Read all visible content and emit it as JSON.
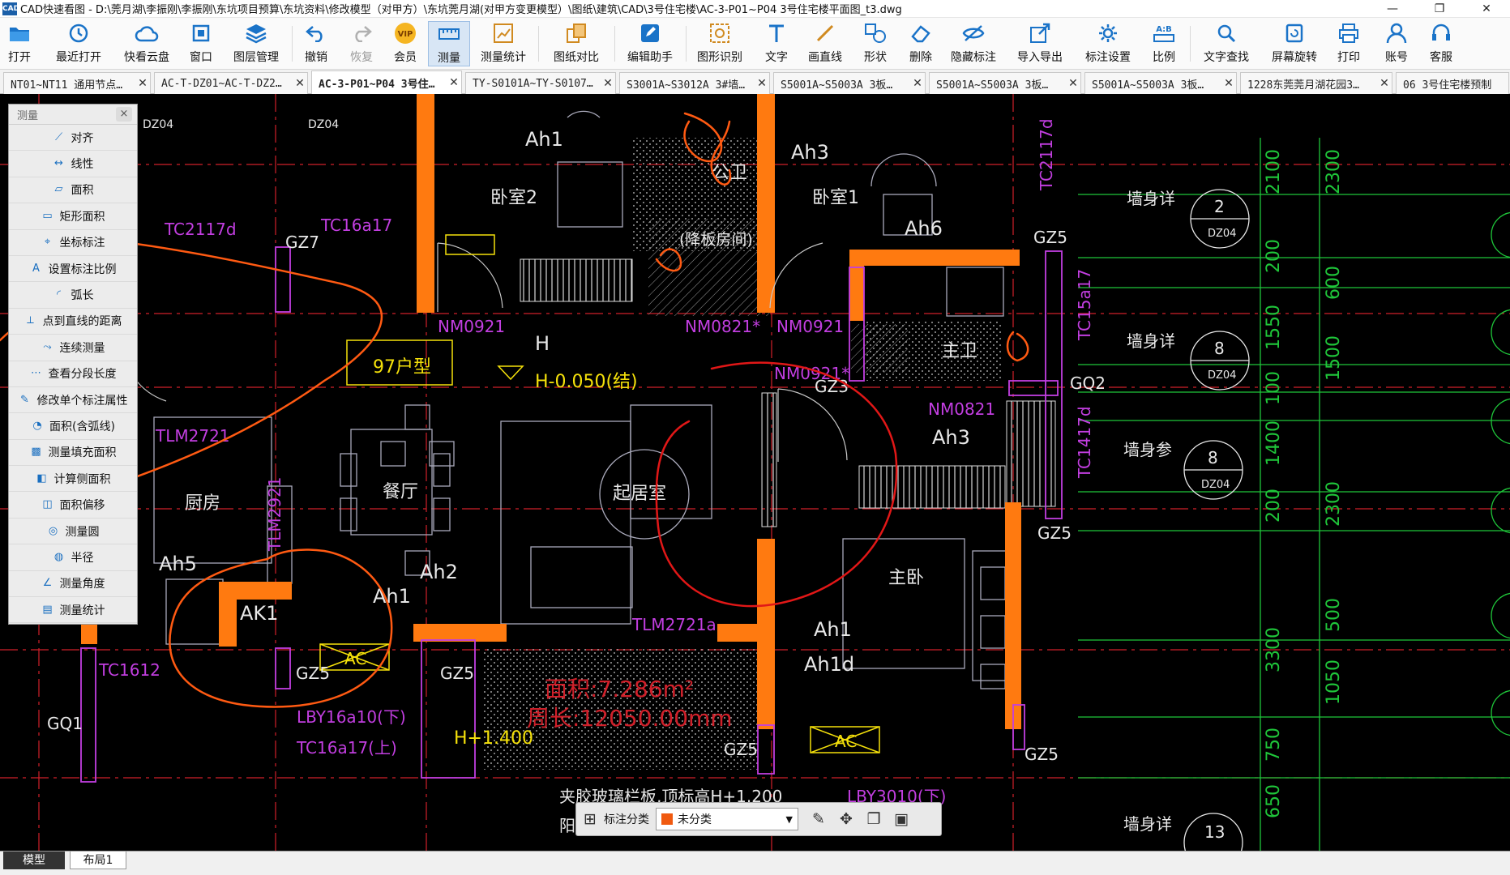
{
  "window": {
    "title": "CAD快速看图 - D:\\莞月湖\\李振刚\\李振刚\\东坑项目预算\\东坑资料\\修改模型（对甲方）\\东坑莞月湖(对甲方变更模型）\\图纸\\建筑\\CAD\\3号住宅楼\\AC-3-P01~P04 3号住宅楼平面图_t3.dwg",
    "logo": "CAD",
    "minimize": "—",
    "maximize": "❐",
    "close": "✕"
  },
  "toolbar": [
    {
      "label": "打开",
      "icon": "folder-icon"
    },
    {
      "label": "最近打开",
      "icon": "history-icon"
    },
    {
      "label": "快看云盘",
      "icon": "cloud-icon"
    },
    {
      "label": "窗口",
      "icon": "window-icon"
    },
    {
      "label": "图层管理",
      "icon": "layers-icon"
    },
    {
      "label": "撤销",
      "icon": "undo-icon"
    },
    {
      "label": "恢复",
      "icon": "redo-icon"
    },
    {
      "label": "会员",
      "icon": "vip-icon",
      "badge": "VIP"
    },
    {
      "label": "测量",
      "icon": "ruler-icon"
    },
    {
      "label": "测量统计",
      "icon": "measure-stats-icon"
    },
    {
      "label": "图纸对比",
      "icon": "compare-icon"
    },
    {
      "label": "编辑助手",
      "icon": "edit-helper-icon"
    },
    {
      "label": "图形识别",
      "icon": "shape-recognize-icon"
    },
    {
      "label": "文字",
      "icon": "text-icon"
    },
    {
      "label": "画直线",
      "icon": "line-icon"
    },
    {
      "label": "形状",
      "icon": "shape-icon"
    },
    {
      "label": "删除",
      "icon": "eraser-icon"
    },
    {
      "label": "隐藏标注",
      "icon": "eye-hide-icon"
    },
    {
      "label": "导入导出",
      "icon": "import-export-icon"
    },
    {
      "label": "标注设置",
      "icon": "annotation-settings-icon"
    },
    {
      "label": "比例",
      "icon": "scale-icon",
      "badge": "A:B"
    },
    {
      "label": "文字查找",
      "icon": "text-search-icon"
    },
    {
      "label": "屏幕旋转",
      "icon": "rotate-screen-icon"
    },
    {
      "label": "打印",
      "icon": "print-icon"
    },
    {
      "label": "账号",
      "icon": "user-icon"
    },
    {
      "label": "客服",
      "icon": "headset-icon"
    }
  ],
  "tabs": [
    {
      "label": "NT01~NT11 通用节点…",
      "close": "✕"
    },
    {
      "label": "AC-T-DZ01~AC-T-DZ2…",
      "close": "✕"
    },
    {
      "label": "AC-3-P01~P04 3号住…",
      "close": "✕",
      "active": true
    },
    {
      "label": "TY-S0101A~TY-S0107…",
      "close": "✕"
    },
    {
      "label": "S3001A~S3012A 3#墙…",
      "close": "✕"
    },
    {
      "label": "S5001A~S5003A 3板…",
      "close": "✕"
    },
    {
      "label": "S5001A~S5003A 3板…",
      "close": "✕"
    },
    {
      "label": "S5001A~S5003A 3板…",
      "close": "✕"
    },
    {
      "label": "1228东莞莞月湖花园3…",
      "close": "✕"
    },
    {
      "label": "06 3号住宅楼预制",
      "close": ""
    }
  ],
  "measure_panel": {
    "title": "测量",
    "close": "×",
    "items": [
      {
        "label": "对齐",
        "icon": "align-measure-icon",
        "glyph": "⟋"
      },
      {
        "label": "线性",
        "icon": "linear-measure-icon",
        "glyph": "↔"
      },
      {
        "label": "面积",
        "icon": "area-measure-icon",
        "glyph": "▱"
      },
      {
        "label": "矩形面积",
        "icon": "rect-area-icon",
        "glyph": "▭"
      },
      {
        "label": "坐标标注",
        "icon": "coordinate-icon",
        "glyph": "⌖"
      },
      {
        "label": "设置标注比例",
        "icon": "scale-setting-icon",
        "glyph": "A"
      },
      {
        "label": "弧长",
        "icon": "arc-length-icon",
        "glyph": "◜"
      },
      {
        "label": "点到直线的距离",
        "icon": "point-line-distance-icon",
        "glyph": "⟂"
      },
      {
        "label": "连续测量",
        "icon": "continuous-measure-icon",
        "glyph": "⤳"
      },
      {
        "label": "查看分段长度",
        "icon": "segment-length-icon",
        "glyph": "⋯"
      },
      {
        "label": "修改单个标注属性",
        "icon": "edit-annotation-icon",
        "glyph": "✎"
      },
      {
        "label": "面积(含弧线)",
        "icon": "arc-area-icon",
        "glyph": "◔"
      },
      {
        "label": "测量填充面积",
        "icon": "fill-area-icon",
        "glyph": "▩"
      },
      {
        "label": "计算侧面积",
        "icon": "side-area-icon",
        "glyph": "◧"
      },
      {
        "label": "面积偏移",
        "icon": "area-offset-icon",
        "glyph": "◫"
      },
      {
        "label": "测量圆",
        "icon": "circle-measure-icon",
        "glyph": "◎"
      },
      {
        "label": "半径",
        "icon": "radius-icon",
        "glyph": "◍"
      },
      {
        "label": "测量角度",
        "icon": "angle-icon",
        "glyph": "∠"
      },
      {
        "label": "测量统计",
        "icon": "stats-icon",
        "glyph": "▤"
      }
    ]
  },
  "annotation_bar": {
    "label": "标注分类",
    "selected": "未分类",
    "swatch_color": "#f05a10",
    "icons": [
      "grid-icon",
      "edit-annotation-icon",
      "move-icon",
      "copy-icon",
      "paste-icon"
    ]
  },
  "bottom_tabs": [
    {
      "label": "模型",
      "active": true
    },
    {
      "label": "布局1",
      "active": false
    }
  ],
  "drawing": {
    "rooms": {
      "bedroom2": "卧室2",
      "bedroom1": "卧室1",
      "public_bath": "公卫",
      "bath_note": "(降板房间)",
      "living": "起居室",
      "dining": "餐厅",
      "kitchen": "厨房",
      "master": "主卧",
      "master_bath": "主卫",
      "unit_type": "97户型"
    },
    "tags": {
      "ah1a": "Ah1",
      "ah3a": "Ah3",
      "ah6": "Ah6",
      "ah3b": "Ah3",
      "ah5": "Ah5",
      "ah2": "Ah2",
      "ah1b": "Ah1",
      "ah1c": "Ah1",
      "ah1d": "Ah1d",
      "ak1": "AK1",
      "h": "H",
      "level": "H-0.050(结)",
      "level2": "H+1.400",
      "gz7": "GZ7",
      "gz3": "GZ3",
      "gz5a": "GZ5",
      "gz5b": "GZ5",
      "gz5c": "GZ5",
      "gz5d": "GZ5",
      "gz5e": "GZ5",
      "gz5f": "GZ5",
      "gq1": "GQ1",
      "gq2": "GQ2",
      "ac1": "AC",
      "ac2": "AC",
      "dz04a": "DZ04",
      "dz04b": "DZ04"
    },
    "doors": {
      "nm0921a": "NM0921",
      "nm0821a": "NM0821*",
      "nm0921b": "NM0921",
      "nm0921c": "NM0921*",
      "nm0821b": "NM0821"
    },
    "windows": {
      "tc2117a": "TC2117d",
      "tc16a17a": "TC16a17",
      "tlm2721": "TLM2721",
      "tlm2921": "TLM2921",
      "tc1612": "TC1612",
      "lby16a10": "LBY16a10(下)",
      "tc16a17b": "TC16a17(上)",
      "tlm2721a": "TLM2721a",
      "lby3010": "LBY3010(下)",
      "tc2117b": "TC2117d",
      "tc15a17": "TC15a17",
      "tc1417": "TC1417d"
    },
    "measurement": {
      "area": "面积:7.286m²",
      "perimeter": "周长:12050.00mm"
    },
    "notes": {
      "glass_rail": "夹胶玻璃栏板,顶标高H+1.200",
      "balcony": "阳台"
    },
    "wall_callouts": [
      {
        "label": "墙身详",
        "num": "2",
        "ref": "DZ04"
      },
      {
        "label": "墙身详",
        "num": "8",
        "ref": "DZ04"
      },
      {
        "label": "墙身参",
        "num": "8",
        "ref": "DZ04"
      },
      {
        "label": "墙身详",
        "num": "13",
        "ref": ""
      }
    ],
    "dims_a": [
      "2100",
      "200",
      "1550",
      "100",
      "1400",
      "200",
      "3300",
      "750",
      "650"
    ],
    "dims_b": [
      "2300",
      "600",
      "1500",
      "2300",
      "500",
      "1050"
    ]
  }
}
